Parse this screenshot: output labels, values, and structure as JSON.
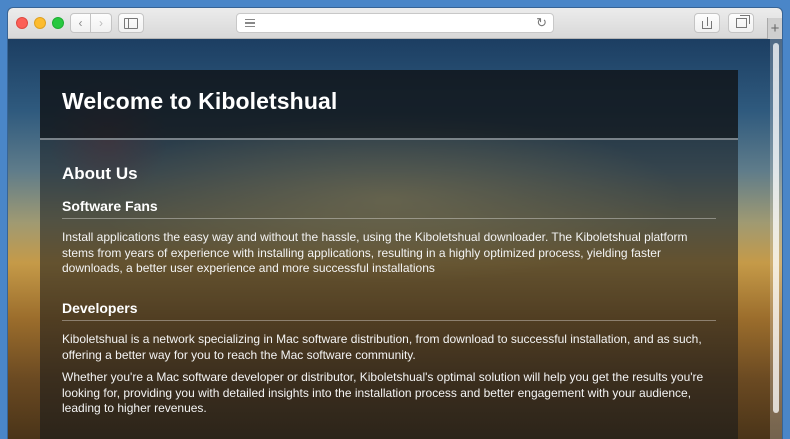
{
  "browser": {
    "address_value": "",
    "icons": {
      "back": "chevron-left-icon",
      "forward": "chevron-right-icon",
      "sidebar": "sidebar-icon",
      "reader": "reader-lines-icon",
      "reload": "reload-icon",
      "share": "share-icon",
      "tabs": "tabs-overview-icon",
      "new_tab": "plus-icon"
    }
  },
  "page": {
    "header_title": "Welcome to Kiboletshual",
    "about_heading": "About Us",
    "sections": [
      {
        "title": "Software Fans",
        "paragraphs": [
          "Install applications the easy way and without the hassle, using the Kiboletshual downloader. The Kiboletshual platform stems from years of experience with installing applications, resulting in a highly optimized process, yielding faster downloads, a better user experience and more successful installations"
        ]
      },
      {
        "title": "Developers",
        "paragraphs": [
          "Kiboletshual is a network specializing in Mac software distribution, from download to successful installation, and as such, offering a better way for you to reach the Mac software community.",
          "Whether you're a Mac software developer or distributor, Kiboletshual's optimal solution will help you get the results you're looking for, providing you with detailed insights into the installation process and better engagement with your audience, leading to higher revenues."
        ]
      }
    ]
  },
  "colors": {
    "background": "#4a86c8",
    "panel_text": "#ffffff"
  }
}
